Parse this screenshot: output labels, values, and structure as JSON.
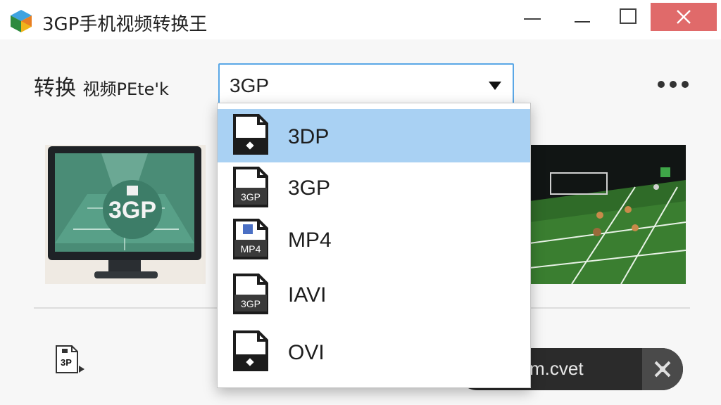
{
  "window": {
    "title": "3GP手机视频转换王",
    "controls": [
      "minimize-icon",
      "maximize-icon",
      "close-icon"
    ]
  },
  "toolbar": {
    "convert_label_main": "转换",
    "convert_label_tail": "视频PEte'k",
    "format_selected": "3GP",
    "more_icon": "more-dots-icon"
  },
  "dropdown": {
    "items": [
      {
        "label": "3DP",
        "icon_text": "",
        "selected": true
      },
      {
        "label": "3GP",
        "icon_text": "3GP",
        "selected": false
      },
      {
        "label": "MP4",
        "icon_text": "MP4",
        "selected": false
      },
      {
        "label": "IAVI",
        "icon_text": "3GP",
        "selected": false
      },
      {
        "label": "OVI",
        "icon_text": "",
        "selected": false
      }
    ]
  },
  "preview_left": {
    "badge_text": "3GP"
  },
  "bottom": {
    "format_icon_text": "3P",
    "filename": "m.cvet"
  },
  "colors": {
    "accent": "#5aa7e6",
    "selected_bg": "#a9d1f3",
    "close_button": "#e06a6a",
    "pill_bg": "#2b2b2b"
  }
}
